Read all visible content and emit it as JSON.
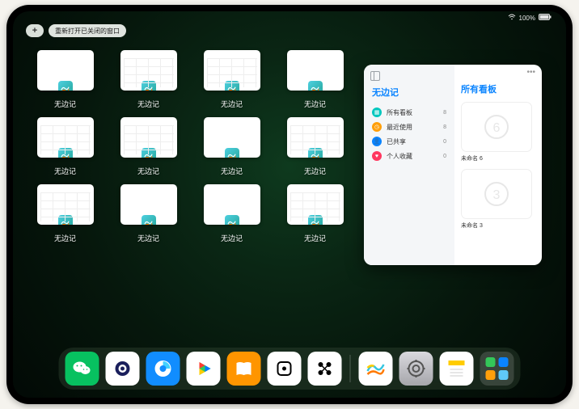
{
  "status": {
    "battery": "100%"
  },
  "topbar": {
    "reopen_label": "重新打开已关闭的窗口"
  },
  "app_name": "无边记",
  "windows": [
    {
      "label": "无边记",
      "variant": "blank"
    },
    {
      "label": "无边记",
      "variant": "grid"
    },
    {
      "label": "无边记",
      "variant": "grid"
    },
    {
      "label": "无边记",
      "variant": "blank"
    },
    {
      "label": "无边记",
      "variant": "grid"
    },
    {
      "label": "无边记",
      "variant": "grid"
    },
    {
      "label": "无边记",
      "variant": "blank"
    },
    {
      "label": "无边记",
      "variant": "grid"
    },
    {
      "label": "无边记",
      "variant": "grid"
    },
    {
      "label": "无边记",
      "variant": "blank"
    },
    {
      "label": "无边记",
      "variant": "blank"
    },
    {
      "label": "无边记",
      "variant": "grid"
    }
  ],
  "sidebar": {
    "title": "无边记",
    "items": [
      {
        "icon": "grid",
        "color": "#00c7be",
        "label": "所有看板",
        "count": "8"
      },
      {
        "icon": "clock",
        "color": "#ff9f0a",
        "label": "最近使用",
        "count": "8"
      },
      {
        "icon": "person",
        "color": "#0a84ff",
        "label": "已共享",
        "count": "0"
      },
      {
        "icon": "heart",
        "color": "#ff375f",
        "label": "个人收藏",
        "count": "0"
      }
    ]
  },
  "main_panel": {
    "title": "所有看板",
    "boards": [
      {
        "name": "未命名 6",
        "digit": "6"
      },
      {
        "name": "未命名 3",
        "digit": "3"
      }
    ]
  },
  "dock": {
    "apps": [
      {
        "name": "wechat",
        "bg": "#07c160"
      },
      {
        "name": "quark",
        "bg": "#ffffff"
      },
      {
        "name": "qqbrowser",
        "bg": "#118dff"
      },
      {
        "name": "play-video",
        "bg": "#ffffff"
      },
      {
        "name": "books",
        "bg": "#ff9500"
      },
      {
        "name": "dice",
        "bg": "#ffffff"
      },
      {
        "name": "nodes",
        "bg": "#ffffff"
      },
      {
        "name": "freeform",
        "bg": "#ffffff"
      },
      {
        "name": "settings",
        "bg": "linear-gradient(#d9d9de,#a6a6ab)"
      },
      {
        "name": "notes",
        "bg": "#ffffff"
      }
    ]
  }
}
